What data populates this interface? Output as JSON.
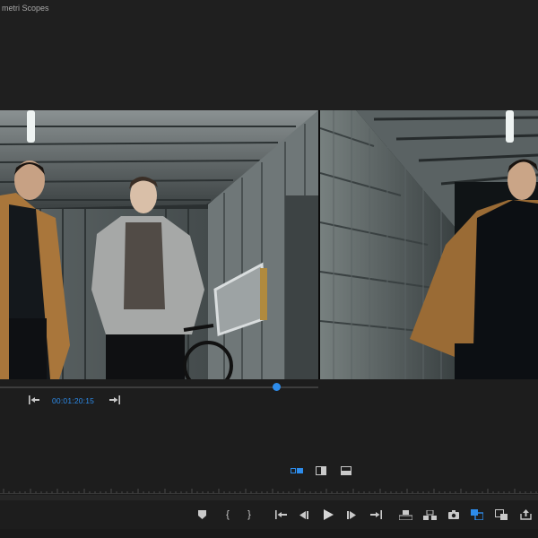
{
  "panel": {
    "title": "metri Scopes"
  },
  "playback": {
    "timecode": "00:01:20:15",
    "playhead_fraction": 0.87
  },
  "icons": {
    "go_to_in": "go-to-in-point-icon",
    "go_to_out": "go-to-out-point-icon",
    "marker": "add-marker-icon",
    "mark_in": "mark-in-icon",
    "mark_out": "mark-out-icon",
    "step_back": "step-back-icon",
    "play": "play-icon",
    "step_forward": "step-forward-icon",
    "lift": "lift-icon",
    "extract": "extract-icon",
    "export_frame": "camera-icon",
    "comparison_view": "comparison-view-icon",
    "button_editor": "button-editor-icon"
  },
  "colors": {
    "accent": "#2d8ceb",
    "background": "#1d1d1d"
  }
}
